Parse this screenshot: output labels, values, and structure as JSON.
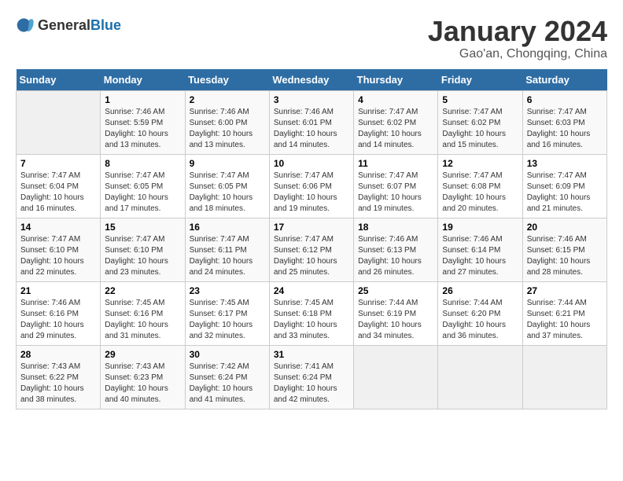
{
  "header": {
    "logo_general": "General",
    "logo_blue": "Blue",
    "month_year": "January 2024",
    "location": "Gao'an, Chongqing, China"
  },
  "columns": [
    "Sunday",
    "Monday",
    "Tuesday",
    "Wednesday",
    "Thursday",
    "Friday",
    "Saturday"
  ],
  "weeks": [
    [
      {
        "day": "",
        "sunrise": "",
        "sunset": "",
        "daylight": ""
      },
      {
        "day": "1",
        "sunrise": "Sunrise: 7:46 AM",
        "sunset": "Sunset: 5:59 PM",
        "daylight": "Daylight: 10 hours and 13 minutes."
      },
      {
        "day": "2",
        "sunrise": "Sunrise: 7:46 AM",
        "sunset": "Sunset: 6:00 PM",
        "daylight": "Daylight: 10 hours and 13 minutes."
      },
      {
        "day": "3",
        "sunrise": "Sunrise: 7:46 AM",
        "sunset": "Sunset: 6:01 PM",
        "daylight": "Daylight: 10 hours and 14 minutes."
      },
      {
        "day": "4",
        "sunrise": "Sunrise: 7:47 AM",
        "sunset": "Sunset: 6:02 PM",
        "daylight": "Daylight: 10 hours and 14 minutes."
      },
      {
        "day": "5",
        "sunrise": "Sunrise: 7:47 AM",
        "sunset": "Sunset: 6:02 PM",
        "daylight": "Daylight: 10 hours and 15 minutes."
      },
      {
        "day": "6",
        "sunrise": "Sunrise: 7:47 AM",
        "sunset": "Sunset: 6:03 PM",
        "daylight": "Daylight: 10 hours and 16 minutes."
      }
    ],
    [
      {
        "day": "7",
        "sunrise": "Sunrise: 7:47 AM",
        "sunset": "Sunset: 6:04 PM",
        "daylight": "Daylight: 10 hours and 16 minutes."
      },
      {
        "day": "8",
        "sunrise": "Sunrise: 7:47 AM",
        "sunset": "Sunset: 6:05 PM",
        "daylight": "Daylight: 10 hours and 17 minutes."
      },
      {
        "day": "9",
        "sunrise": "Sunrise: 7:47 AM",
        "sunset": "Sunset: 6:05 PM",
        "daylight": "Daylight: 10 hours and 18 minutes."
      },
      {
        "day": "10",
        "sunrise": "Sunrise: 7:47 AM",
        "sunset": "Sunset: 6:06 PM",
        "daylight": "Daylight: 10 hours and 19 minutes."
      },
      {
        "day": "11",
        "sunrise": "Sunrise: 7:47 AM",
        "sunset": "Sunset: 6:07 PM",
        "daylight": "Daylight: 10 hours and 19 minutes."
      },
      {
        "day": "12",
        "sunrise": "Sunrise: 7:47 AM",
        "sunset": "Sunset: 6:08 PM",
        "daylight": "Daylight: 10 hours and 20 minutes."
      },
      {
        "day": "13",
        "sunrise": "Sunrise: 7:47 AM",
        "sunset": "Sunset: 6:09 PM",
        "daylight": "Daylight: 10 hours and 21 minutes."
      }
    ],
    [
      {
        "day": "14",
        "sunrise": "Sunrise: 7:47 AM",
        "sunset": "Sunset: 6:10 PM",
        "daylight": "Daylight: 10 hours and 22 minutes."
      },
      {
        "day": "15",
        "sunrise": "Sunrise: 7:47 AM",
        "sunset": "Sunset: 6:10 PM",
        "daylight": "Daylight: 10 hours and 23 minutes."
      },
      {
        "day": "16",
        "sunrise": "Sunrise: 7:47 AM",
        "sunset": "Sunset: 6:11 PM",
        "daylight": "Daylight: 10 hours and 24 minutes."
      },
      {
        "day": "17",
        "sunrise": "Sunrise: 7:47 AM",
        "sunset": "Sunset: 6:12 PM",
        "daylight": "Daylight: 10 hours and 25 minutes."
      },
      {
        "day": "18",
        "sunrise": "Sunrise: 7:46 AM",
        "sunset": "Sunset: 6:13 PM",
        "daylight": "Daylight: 10 hours and 26 minutes."
      },
      {
        "day": "19",
        "sunrise": "Sunrise: 7:46 AM",
        "sunset": "Sunset: 6:14 PM",
        "daylight": "Daylight: 10 hours and 27 minutes."
      },
      {
        "day": "20",
        "sunrise": "Sunrise: 7:46 AM",
        "sunset": "Sunset: 6:15 PM",
        "daylight": "Daylight: 10 hours and 28 minutes."
      }
    ],
    [
      {
        "day": "21",
        "sunrise": "Sunrise: 7:46 AM",
        "sunset": "Sunset: 6:16 PM",
        "daylight": "Daylight: 10 hours and 29 minutes."
      },
      {
        "day": "22",
        "sunrise": "Sunrise: 7:45 AM",
        "sunset": "Sunset: 6:16 PM",
        "daylight": "Daylight: 10 hours and 31 minutes."
      },
      {
        "day": "23",
        "sunrise": "Sunrise: 7:45 AM",
        "sunset": "Sunset: 6:17 PM",
        "daylight": "Daylight: 10 hours and 32 minutes."
      },
      {
        "day": "24",
        "sunrise": "Sunrise: 7:45 AM",
        "sunset": "Sunset: 6:18 PM",
        "daylight": "Daylight: 10 hours and 33 minutes."
      },
      {
        "day": "25",
        "sunrise": "Sunrise: 7:44 AM",
        "sunset": "Sunset: 6:19 PM",
        "daylight": "Daylight: 10 hours and 34 minutes."
      },
      {
        "day": "26",
        "sunrise": "Sunrise: 7:44 AM",
        "sunset": "Sunset: 6:20 PM",
        "daylight": "Daylight: 10 hours and 36 minutes."
      },
      {
        "day": "27",
        "sunrise": "Sunrise: 7:44 AM",
        "sunset": "Sunset: 6:21 PM",
        "daylight": "Daylight: 10 hours and 37 minutes."
      }
    ],
    [
      {
        "day": "28",
        "sunrise": "Sunrise: 7:43 AM",
        "sunset": "Sunset: 6:22 PM",
        "daylight": "Daylight: 10 hours and 38 minutes."
      },
      {
        "day": "29",
        "sunrise": "Sunrise: 7:43 AM",
        "sunset": "Sunset: 6:23 PM",
        "daylight": "Daylight: 10 hours and 40 minutes."
      },
      {
        "day": "30",
        "sunrise": "Sunrise: 7:42 AM",
        "sunset": "Sunset: 6:24 PM",
        "daylight": "Daylight: 10 hours and 41 minutes."
      },
      {
        "day": "31",
        "sunrise": "Sunrise: 7:41 AM",
        "sunset": "Sunset: 6:24 PM",
        "daylight": "Daylight: 10 hours and 42 minutes."
      },
      {
        "day": "",
        "sunrise": "",
        "sunset": "",
        "daylight": ""
      },
      {
        "day": "",
        "sunrise": "",
        "sunset": "",
        "daylight": ""
      },
      {
        "day": "",
        "sunrise": "",
        "sunset": "",
        "daylight": ""
      }
    ]
  ]
}
